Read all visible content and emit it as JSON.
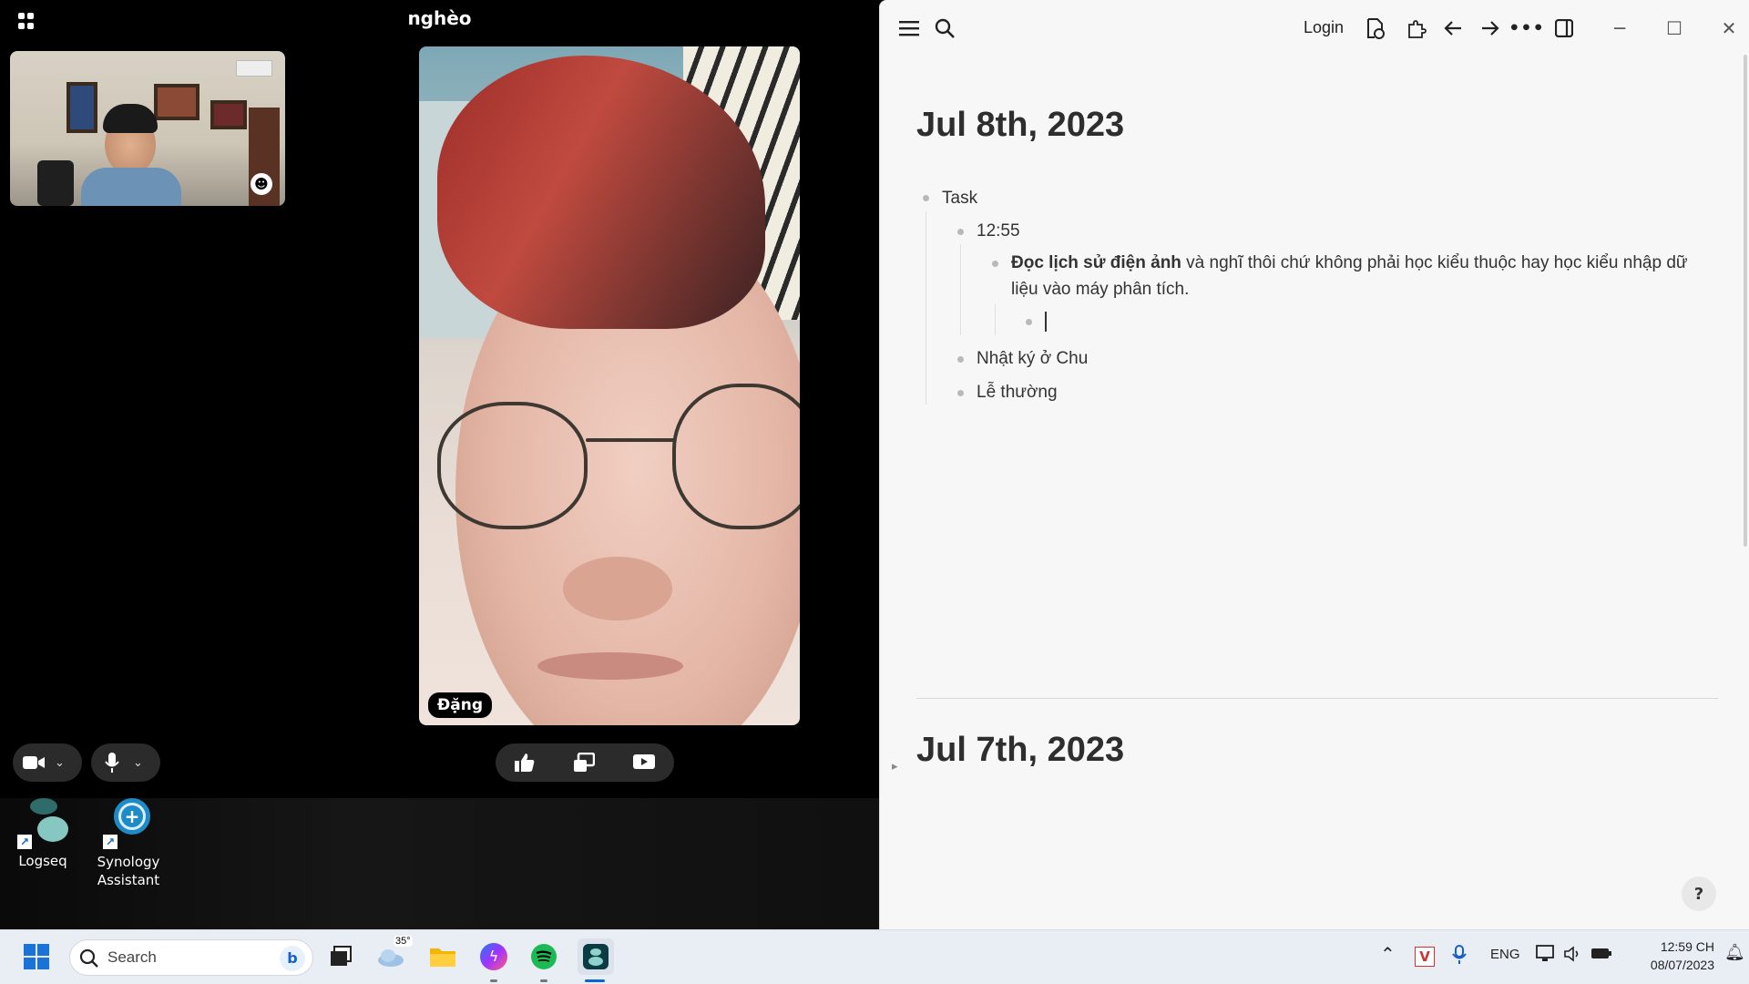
{
  "call": {
    "title": "nghèo",
    "remote_name": "Đặng"
  },
  "desktop": {
    "icons": [
      {
        "label": "Logseq"
      },
      {
        "label": "Synology\nAssistant"
      }
    ]
  },
  "logseq": {
    "login": "Login",
    "journals": [
      {
        "title": "Jul 8th, 2023",
        "blocks": {
          "task": "Task",
          "time": "12:55",
          "note_bold": "Đọc lịch sử điện ảnh",
          "note_line1": " và nghĩ thôi chứ không phải học kiểu thuộc hay học kiểu nhập dữ",
          "note_line2": "liệu vào máy phân tích.",
          "diary": "Nhật ký ở Chu",
          "le": "Lễ thường"
        }
      },
      {
        "title": "Jul 7th, 2023"
      }
    ],
    "help": "?"
  },
  "taskbar": {
    "search_label": "Search",
    "weather_temp": "35°",
    "lang": "ENG",
    "time": "12:59 CH",
    "date": "08/07/2023"
  }
}
